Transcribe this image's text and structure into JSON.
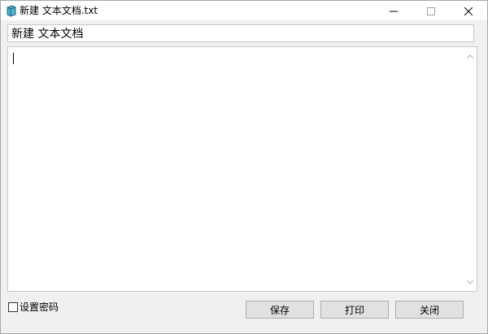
{
  "window": {
    "title": "新建 文本文档.txt",
    "icon": "notepad-book-icon",
    "controls": [
      "minimize-icon",
      "maximize-icon",
      "close-icon"
    ]
  },
  "filename_field": {
    "value": "新建 文本文档"
  },
  "editor": {
    "content": ""
  },
  "footer": {
    "password_label": "设置密码",
    "password_checked": false,
    "buttons": {
      "save": "保存",
      "print": "打印",
      "close": "关闭"
    }
  },
  "colors": {
    "window_bg": "#f0f0f0",
    "button_bg": "#e1e1e1",
    "border": "#adadad"
  }
}
